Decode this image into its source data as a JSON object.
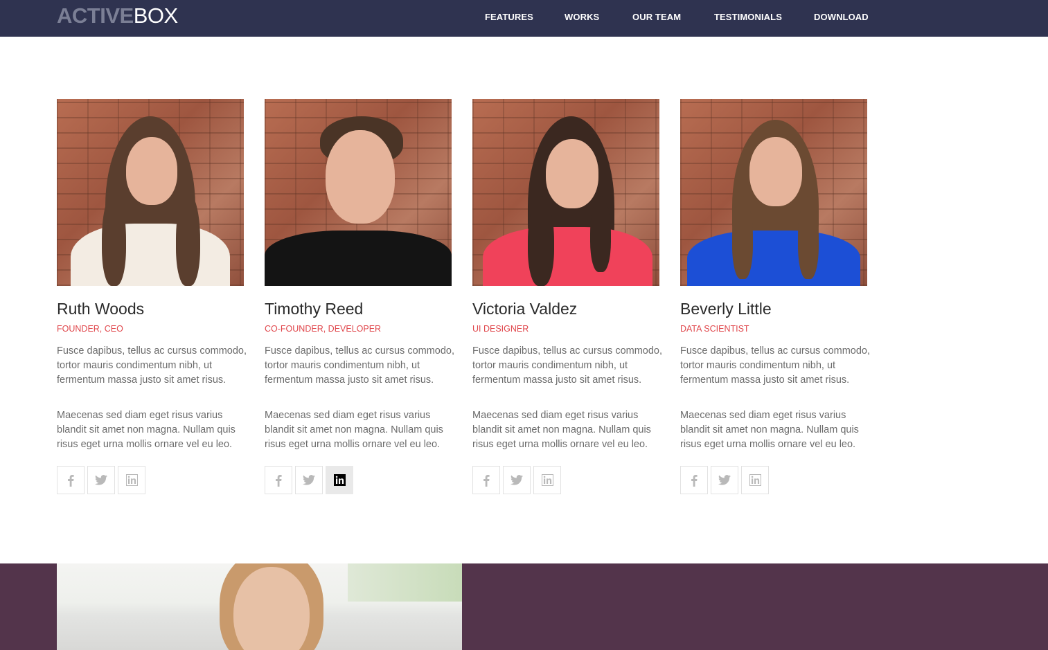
{
  "nav": {
    "logo_part1": "ACTIVE",
    "logo_part2": "BOX",
    "links": [
      "FEATURES",
      "WORKS",
      "OUR TEAM",
      "TESTIMONIALS",
      "DOWNLOAD"
    ]
  },
  "team": [
    {
      "name": "Ruth Woods",
      "role": "FOUNDER, CEO",
      "bio1": "Fusce dapibus, tellus ac cursus commodo, tortor mauris condimentum nibh, ut fermentum massa justo sit amet risus.",
      "bio2": "Maecenas sed diam eget risus varius blandit sit amet non magna. Nullam quis risus eget urna mollis ornare vel eu leo."
    },
    {
      "name": "Timothy Reed",
      "role": "CO-FOUNDER, DEVELOPER",
      "bio1": "Fusce dapibus, tellus ac cursus commodo, tortor mauris condimentum nibh, ut fermentum massa justo sit amet risus.",
      "bio2": "Maecenas sed diam eget risus varius blandit sit amet non magna. Nullam quis risus eget urna mollis ornare vel eu leo."
    },
    {
      "name": "Victoria Valdez",
      "role": "UI DESIGNER",
      "bio1": "Fusce dapibus, tellus ac cursus commodo, tortor mauris condimentum nibh, ut fermentum massa justo sit amet risus.",
      "bio2": "Maecenas sed diam eget risus varius blandit sit amet non magna. Nullam quis risus eget urna mollis ornare vel eu leo."
    },
    {
      "name": "Beverly Little",
      "role": "DATA SCIENTIST",
      "bio1": "Fusce dapibus, tellus ac cursus commodo, tortor mauris condimentum nibh, ut fermentum massa justo sit amet risus.",
      "bio2": "Maecenas sed diam eget risus varius blandit sit amet non magna. Nullam quis risus eget urna mollis ornare vel eu leo."
    }
  ],
  "social_icons": [
    "facebook-icon",
    "twitter-icon",
    "linkedin-icon"
  ],
  "colors": {
    "navbar": "#2f3350",
    "role_accent": "#e0464b",
    "bottom_band": "#53344b"
  }
}
